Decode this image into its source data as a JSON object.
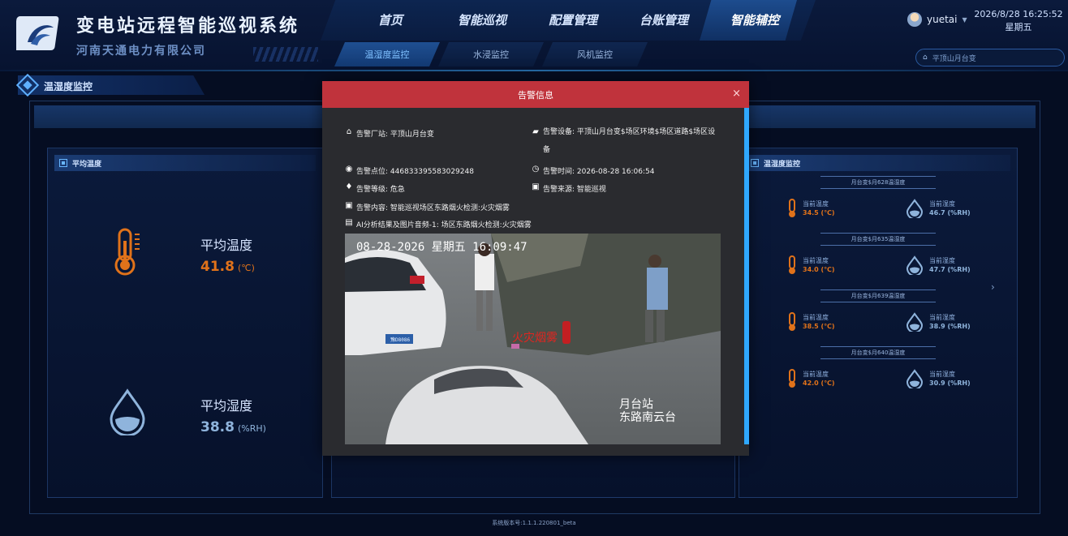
{
  "header": {
    "title": "变电站远程智能巡视系统",
    "company": "河南天通电力有限公司",
    "nav": [
      "首页",
      "智能巡视",
      "配置管理",
      "台账管理",
      "智能辅控"
    ],
    "active_nav": "智能辅控",
    "subnav": [
      "温湿度监控",
      "水浸监控",
      "风机监控"
    ],
    "active_subnav": "温湿度监控",
    "user": "yuetai",
    "datetime": "2026/8/28 16:25:52",
    "weekday": "星期五",
    "station": "平顶山月台变"
  },
  "section": {
    "title": "温湿度监控"
  },
  "left_panel": {
    "title": "平均温度",
    "temp_label": "平均温度",
    "temp_value": "41.8",
    "temp_unit": "(℃)",
    "hum_label": "平均湿度",
    "hum_value": "38.8",
    "hum_unit": "(%RH)"
  },
  "right_panel": {
    "title": "温湿度监控",
    "devices": [
      {
        "name": "月台变$月628温湿度",
        "temp_label": "当前温度",
        "temp": "34.5 (℃)",
        "hum_label": "当前湿度",
        "hum": "46.7 (%RH)"
      },
      {
        "name": "月台变$月635温湿度",
        "temp_label": "当前温度",
        "temp": "34.0 (℃)",
        "hum_label": "当前湿度",
        "hum": "47.7 (%RH)"
      },
      {
        "name": "月台变$月639温湿度",
        "temp_label": "当前温度",
        "temp": "38.5 (℃)",
        "hum_label": "当前湿度",
        "hum": "38.9 (%RH)"
      },
      {
        "name": "月台变$月640温湿度",
        "temp_label": "当前温度",
        "temp": "42.0 (℃)",
        "hum_label": "当前湿度",
        "hum": "30.9 (%RH)"
      }
    ],
    "next_arrow": "›"
  },
  "modal": {
    "title": "告警信息",
    "close": "×",
    "station": "告警厂站: 平顶山月台变",
    "device": "告警设备: 平顶山月台变$场区环境$场区道路$场区设备",
    "point": "告警点位: 446833395583029248",
    "time": "告警时间: 2026-08-28 16:06:54",
    "level": "告警等级: 危急",
    "source": "告警来源: 智能巡视",
    "content": "告警内容: 智能巡视场区东路烟火检测:火灾烟雾",
    "analysis": "AI分析结果及图片音频-1: 场区东路烟火检测:火灾烟雾",
    "snapshot": {
      "osd_time": "08-28-2026 星期五 16:09:47",
      "detect_label": "火灾烟雾",
      "location_line1": "月台站",
      "location_line2": "东路南云台",
      "plate": "豫D8086"
    }
  },
  "footer": {
    "version": "系统版本号:1.1.1.220801_beta"
  },
  "colors": {
    "temp": "#e0721a",
    "hum": "#3ea7ff",
    "alarm": "#c0333c"
  }
}
